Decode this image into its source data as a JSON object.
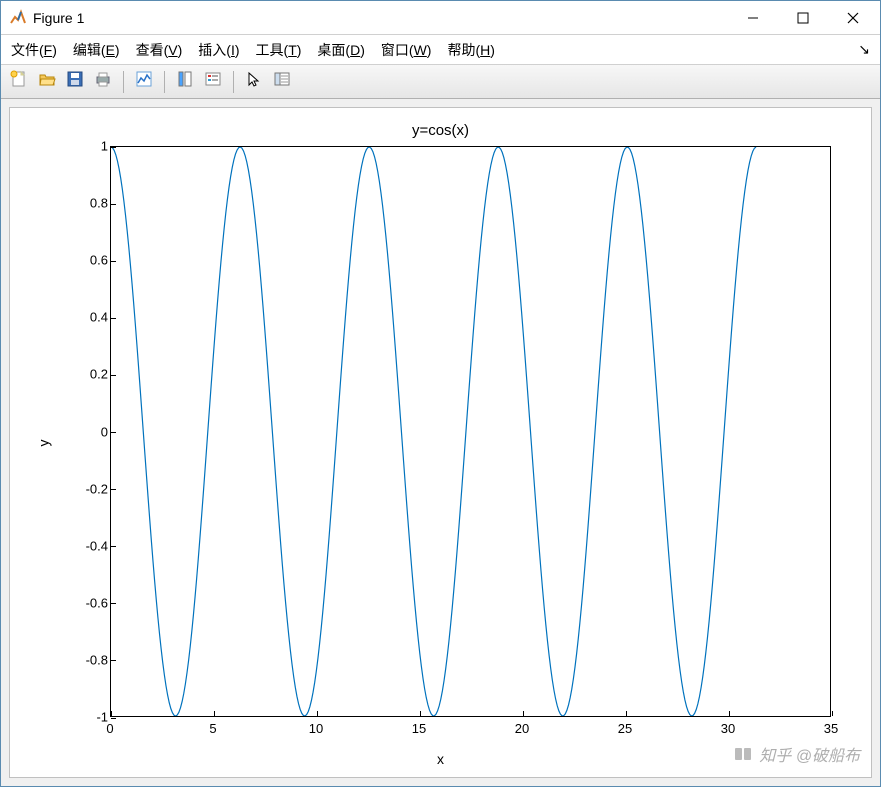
{
  "window": {
    "title": "Figure 1"
  },
  "menubar": {
    "items": [
      {
        "label": "文件",
        "key": "F"
      },
      {
        "label": "编辑",
        "key": "E"
      },
      {
        "label": "查看",
        "key": "V"
      },
      {
        "label": "插入",
        "key": "I"
      },
      {
        "label": "工具",
        "key": "T"
      },
      {
        "label": "桌面",
        "key": "D"
      },
      {
        "label": "窗口",
        "key": "W"
      },
      {
        "label": "帮助",
        "key": "H"
      }
    ]
  },
  "toolbar": {
    "items": [
      {
        "name": "new-figure",
        "icon": "new"
      },
      {
        "name": "open-file",
        "icon": "open"
      },
      {
        "name": "save-figure",
        "icon": "save"
      },
      {
        "name": "print-figure",
        "icon": "print"
      },
      {
        "name": "sep"
      },
      {
        "name": "link-plot",
        "icon": "link"
      },
      {
        "name": "sep"
      },
      {
        "name": "insert-colorbar",
        "icon": "colorbar"
      },
      {
        "name": "insert-legend",
        "icon": "legend"
      },
      {
        "name": "sep"
      },
      {
        "name": "edit-plot",
        "icon": "pointer"
      },
      {
        "name": "open-property-inspector",
        "icon": "inspector"
      }
    ]
  },
  "chart_data": {
    "type": "line",
    "title": "y=cos(x)",
    "xlabel": "x",
    "ylabel": "y",
    "xlim": [
      0,
      35
    ],
    "ylim": [
      -1,
      1
    ],
    "xticks": [
      0,
      5,
      10,
      15,
      20,
      25,
      30,
      35
    ],
    "yticks": [
      -1,
      -0.8,
      -0.6,
      -0.4,
      -0.2,
      0,
      0.2,
      0.4,
      0.6,
      0.8,
      1
    ],
    "series": [
      {
        "name": "cos(x)",
        "color": "#0072bd",
        "function": "cos",
        "domain": [
          0,
          31.4
        ],
        "n_points": 400
      }
    ]
  },
  "watermark": "知乎 @破船布"
}
